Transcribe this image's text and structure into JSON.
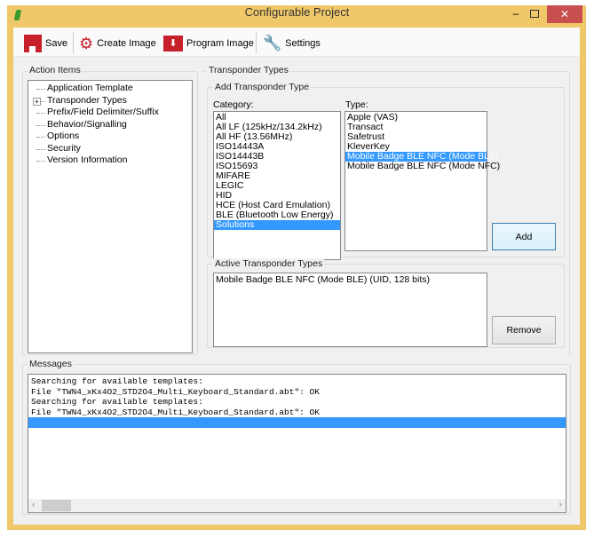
{
  "window": {
    "title": "Configurable Project",
    "colors": {
      "frame": "#f0c869",
      "close": "#c7504f",
      "selection": "#3399ff",
      "icon_red": "#c8202a"
    }
  },
  "toolbar": {
    "save": "Save",
    "create_image": "Create Image",
    "program_image": "Program Image",
    "settings": "Settings"
  },
  "action_items": {
    "label": "Action Items",
    "items": [
      "Application Template",
      "Transponder Types",
      "Prefix/Field Delimiter/Suffix",
      "Behavior/Signalling",
      "Options",
      "Security",
      "Version Information"
    ]
  },
  "transponder": {
    "label": "Transponder Types",
    "add_group": "Add Transponder Type",
    "category_label": "Category:",
    "categories": [
      "All",
      "All LF (125kHz/134.2kHz)",
      "All HF (13.56MHz)",
      "ISO14443A",
      "ISO14443B",
      "ISO15693",
      "MIFARE",
      "LEGIC",
      "HID",
      "HCE (Host Card Emulation)",
      "BLE (Bluetooth Low Energy)",
      "Solutions"
    ],
    "selected_category": "Solutions",
    "type_label": "Type:",
    "types": [
      "Apple (VAS)",
      "Transact",
      "Safetrust",
      "KleverKey",
      "Mobile Badge BLE NFC (Mode BLE)",
      "Mobile Badge BLE NFC (Mode NFC)"
    ],
    "selected_type": "Mobile Badge BLE NFC (Mode BLE)",
    "add": "Add",
    "active_group": "Active Transponder Types",
    "active": [
      "Mobile Badge BLE NFC (Mode BLE) (UID, 128 bits)"
    ],
    "remove": "Remove"
  },
  "messages": {
    "label": "Messages",
    "lines": [
      "Searching for available templates:",
      "File \"TWN4_xKx4O2_STD2O4_Multi_Keyboard_Standard.abt\": OK",
      "Searching for available templates:",
      "File \"TWN4_xKx4O2_STD2O4_Multi_Keyboard_Standard.abt\": OK"
    ]
  }
}
